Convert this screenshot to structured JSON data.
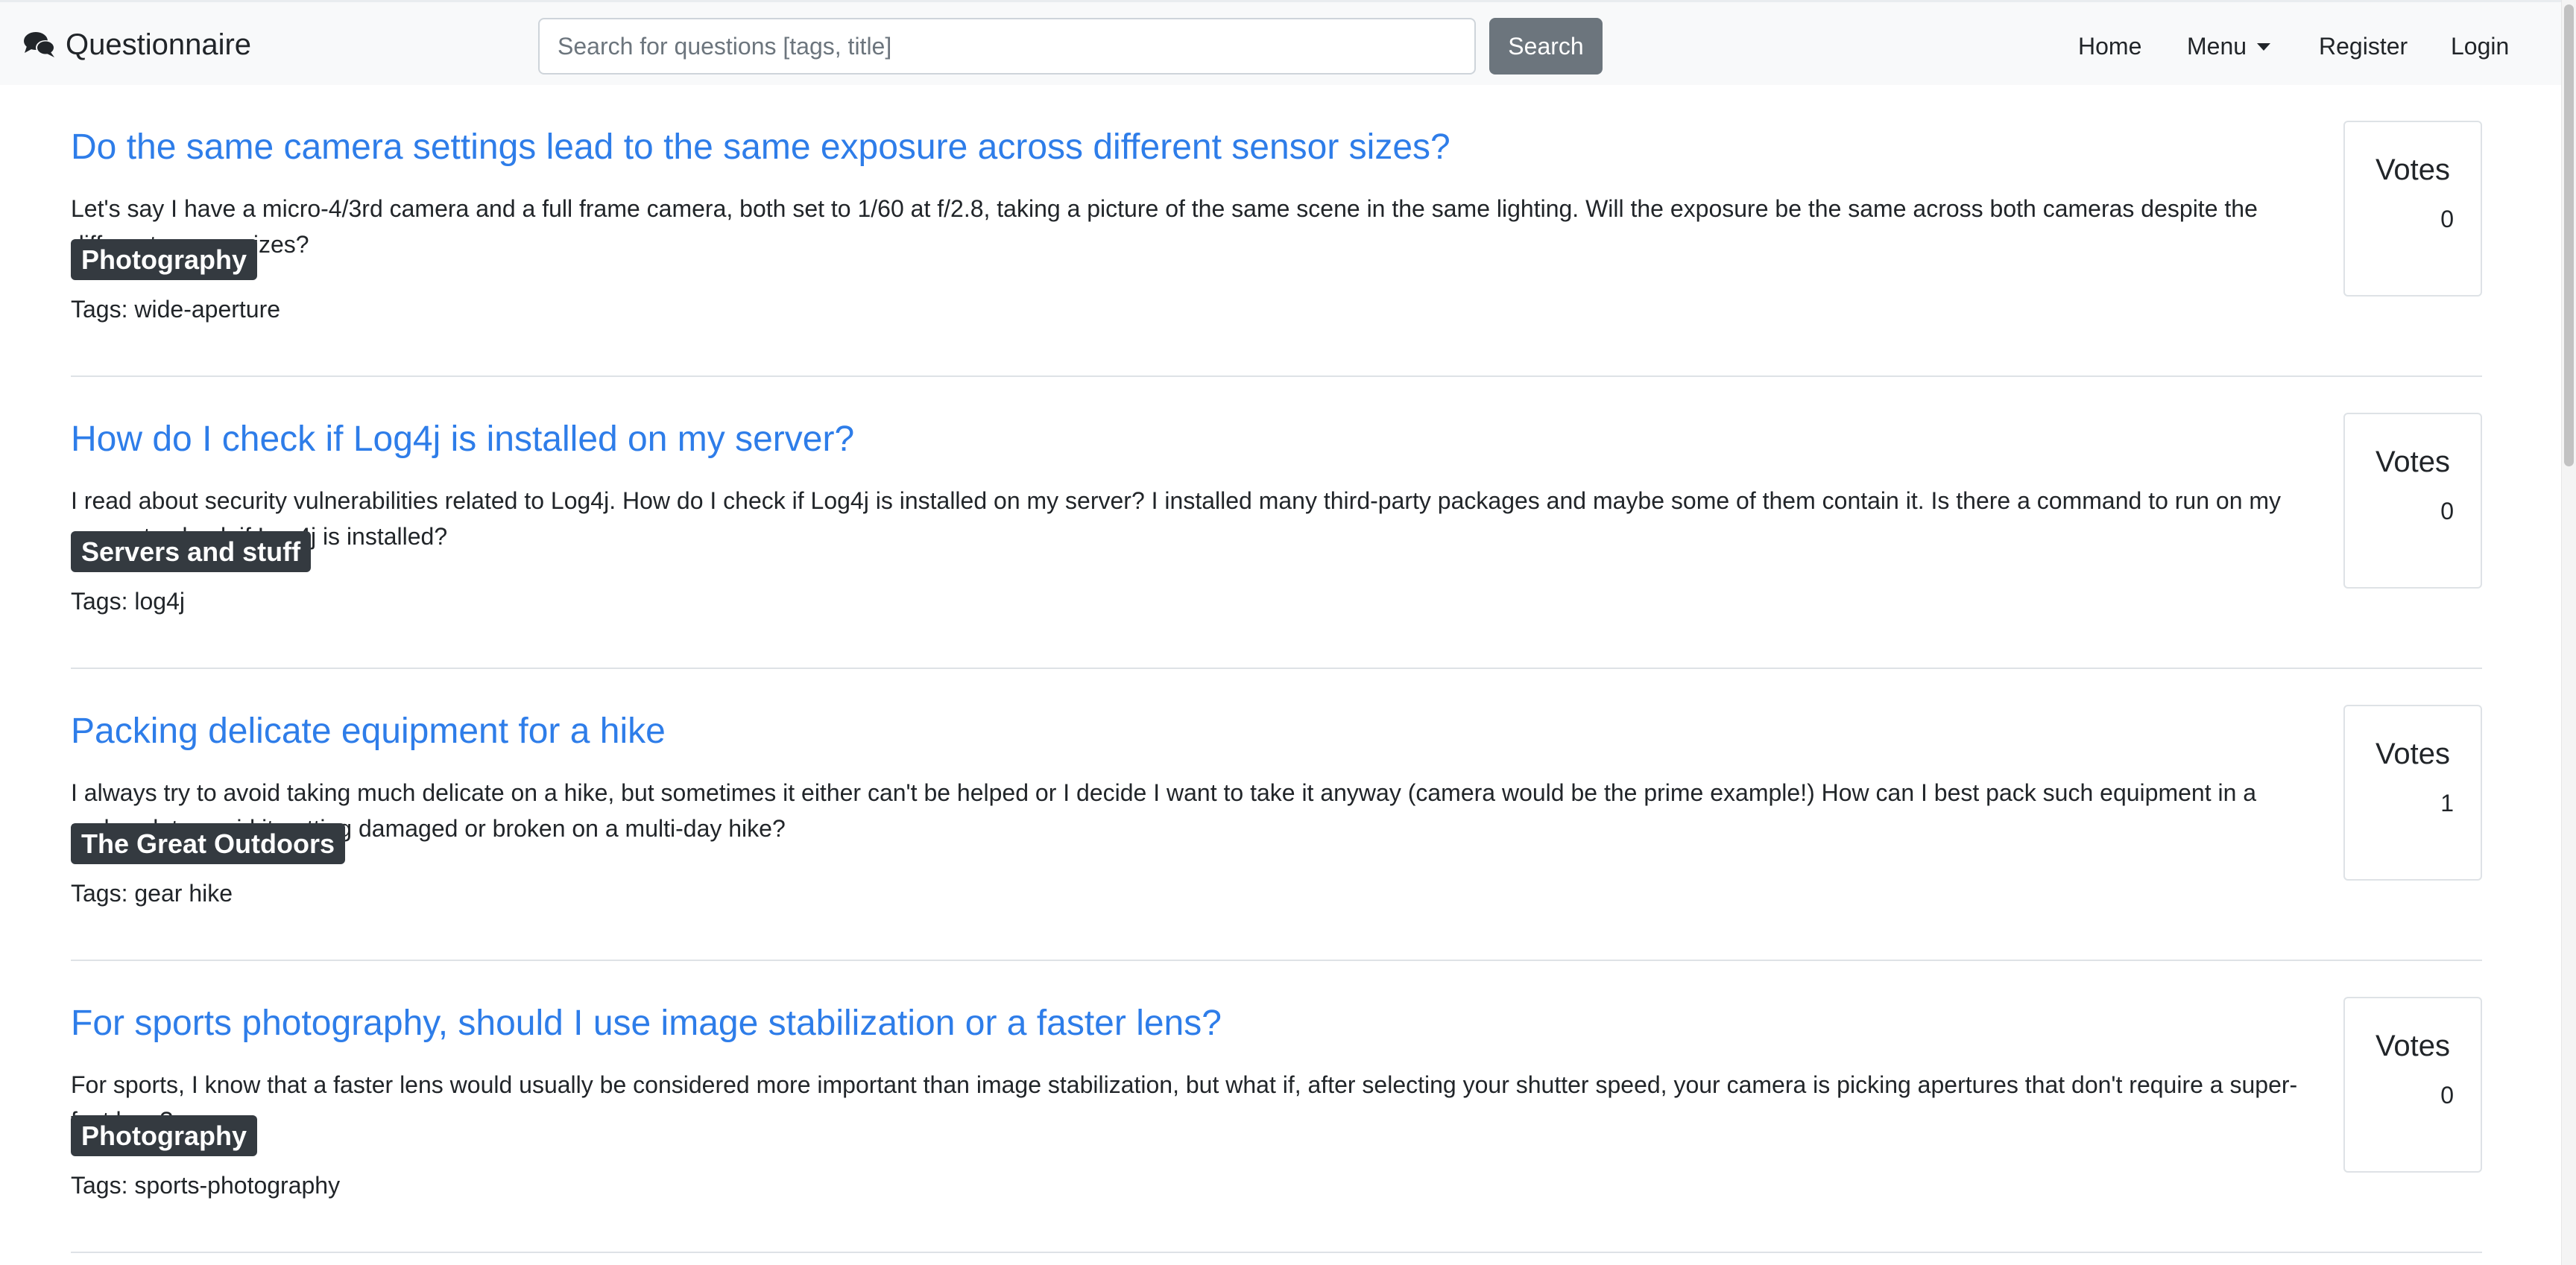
{
  "navbar": {
    "brand": "Questionnaire",
    "brand_icon": "comments-icon",
    "search_placeholder": "Search for questions [tags, title]",
    "search_value": "",
    "search_button": "Search",
    "links": {
      "home": "Home",
      "menu": "Menu",
      "register": "Register",
      "login": "Login"
    }
  },
  "colors": {
    "link": "#2e7de9",
    "badge": "#343a40",
    "navbar_bg": "#f8f9fa",
    "search_button_bg": "#6c757d"
  },
  "questions": [
    {
      "title": "Do the same camera settings lead to the same exposure across different sensor sizes?",
      "body": "Let's say I have a micro-4/3rd camera and a full frame camera, both set to 1/60 at f/2.8, taking a picture of the same scene in the same lighting. Will the exposure be the same across both cameras despite the different sensor sizes?",
      "category": "Photography",
      "tags": "Tags: wide-aperture",
      "votes_label": "Votes",
      "votes": "0"
    },
    {
      "title": "How do I check if Log4j is installed on my server?",
      "body": "I read about security vulnerabilities related to Log4j. How do I check if Log4j is installed on my server? I installed many third-party packages and maybe some of them contain it. Is there a command to run on my server to check if Log4j is installed?",
      "category": "Servers and stuff",
      "tags": "Tags: log4j",
      "votes_label": "Votes",
      "votes": "0"
    },
    {
      "title": "Packing delicate equipment for a hike",
      "body": "I always try to avoid taking much delicate on a hike, but sometimes it either can't be helped or I decide I want to take it anyway (camera would be the prime example!) How can I best pack such equipment in a rucksack to avoid it getting damaged or broken on a multi-day hike?",
      "category": "The Great Outdoors",
      "tags": "Tags: gear hike",
      "votes_label": "Votes",
      "votes": "1"
    },
    {
      "title": "For sports photography, should I use image stabilization or a faster lens?",
      "body": "For sports, I know that a faster lens would usually be considered more important than image stabilization, but what if, after selecting your shutter speed, your camera is picking apertures that don't require a super-fast lens?",
      "category": "Photography",
      "tags": "Tags: sports-photography",
      "votes_label": "Votes",
      "votes": "0"
    }
  ]
}
